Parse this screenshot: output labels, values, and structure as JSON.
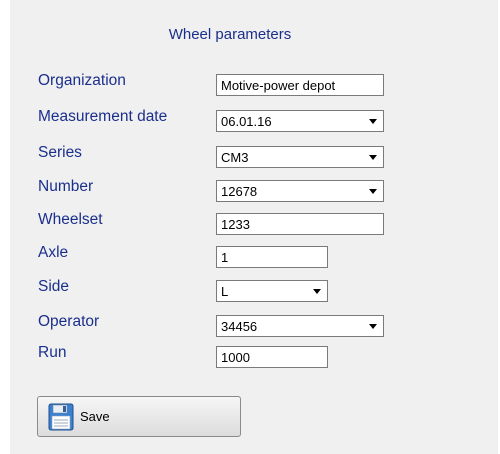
{
  "form": {
    "title": "Wheel parameters",
    "labels": {
      "organization": "Organization",
      "measurement_date": "Measurement date",
      "series": "Series",
      "number": "Number",
      "wheelset": "Wheelset",
      "axle": "Axle",
      "side": "Side",
      "operator": "Operator",
      "run": "Run"
    },
    "values": {
      "organization": "Motive-power depot",
      "measurement_date": "06.01.16",
      "series": "CM3",
      "number": "12678",
      "wheelset": "1233",
      "axle": "1",
      "side": "L",
      "operator": "34456",
      "run": "1000"
    },
    "save_label": "Save"
  },
  "icons": {
    "save": "floppy-disk-icon",
    "dropdown": "chevron-down-icon"
  },
  "colors": {
    "label_text": "#1a2f8c",
    "panel_background": "#f0f0f0"
  }
}
